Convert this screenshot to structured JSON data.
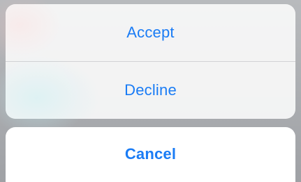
{
  "action_sheet": {
    "actions": [
      {
        "label": "Accept"
      },
      {
        "label": "Decline"
      }
    ],
    "cancel_label": "Cancel"
  },
  "colors": {
    "action_text": "#1a7cf5",
    "sheet_background": "#f8f8f8",
    "cancel_background": "#ffffff"
  }
}
